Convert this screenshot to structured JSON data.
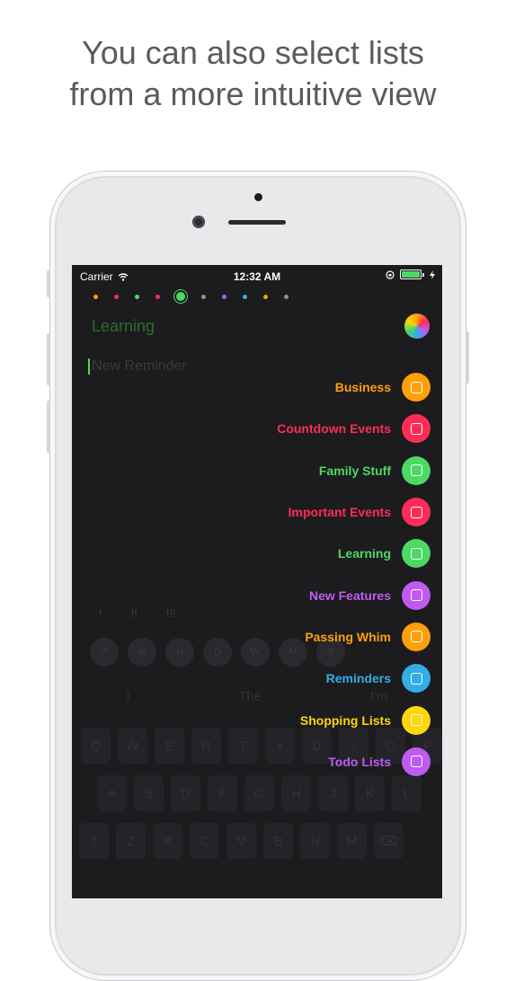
{
  "caption": {
    "line1": "You can also select lists",
    "line2": "from a more intuitive view"
  },
  "status_bar": {
    "carrier": "Carrier",
    "time": "12:32 AM"
  },
  "page_dots": [
    "#ff9f0a",
    "#ff2d55",
    "#4cd964",
    "#ff2d55",
    "#4cd964",
    "#8e8e93",
    "#bf5af2",
    "#32ade6",
    "#ff9f0a",
    "#8e8e93"
  ],
  "current_list": "Learning",
  "new_reminder_placeholder": "New Reminder",
  "lists": [
    {
      "label": "Business",
      "color": "#ff9f0a"
    },
    {
      "label": "Countdown Events",
      "color": "#ff2d55"
    },
    {
      "label": "Family Stuff",
      "color": "#4cd964"
    },
    {
      "label": "Important Events",
      "color": "#ff2d55"
    },
    {
      "label": "Learning",
      "color": "#4cd964"
    },
    {
      "label": "New Features",
      "color": "#bf5af2"
    },
    {
      "label": "Passing Whim",
      "color": "#ff9f0a"
    },
    {
      "label": "Reminders",
      "color": "#32ade6"
    },
    {
      "label": "Shopping Lists",
      "color": "#ffd60a"
    },
    {
      "label": "Todo Lists",
      "color": "#bf5af2"
    }
  ],
  "priority_marks": [
    "!",
    "!!",
    "!!!"
  ],
  "repeat_pills": [
    "⟳",
    "m",
    "H",
    "D",
    "W",
    "M",
    "Y"
  ],
  "suggestions": [
    "I",
    "The",
    "I'm"
  ],
  "keyboard": {
    "row1": [
      "Q",
      "W",
      "E",
      "R",
      "T",
      "Y",
      "U",
      "I",
      "O",
      "P"
    ],
    "row2": [
      "A",
      "S",
      "D",
      "F",
      "G",
      "H",
      "J",
      "K",
      "L"
    ],
    "row3": [
      "⇧",
      "Z",
      "X",
      "C",
      "V",
      "B",
      "N",
      "M",
      "⌫"
    ]
  }
}
